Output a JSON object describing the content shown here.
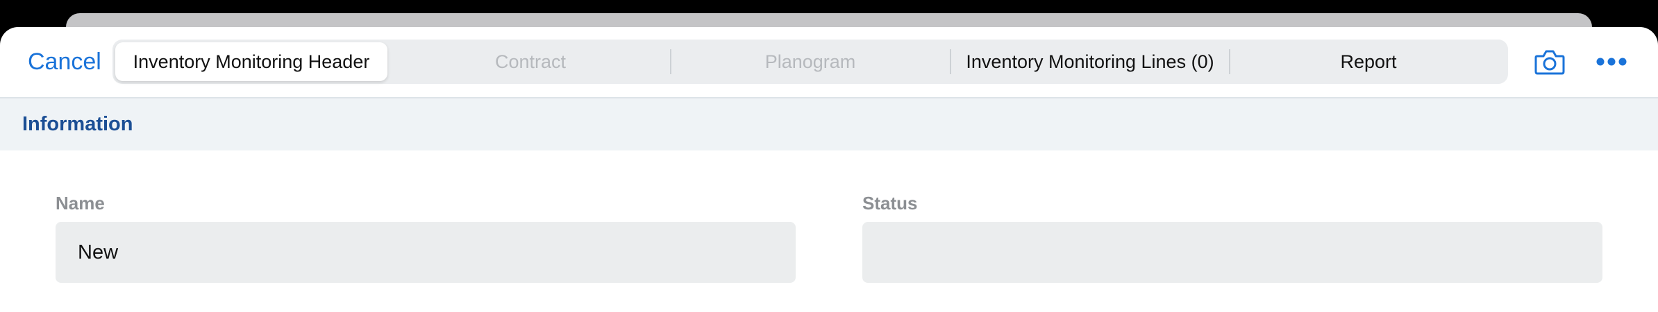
{
  "toolbar": {
    "cancel_label": "Cancel",
    "tabs": [
      {
        "label": "Inventory Monitoring Header",
        "state": "active"
      },
      {
        "label": "Contract",
        "state": "disabled"
      },
      {
        "label": "Planogram",
        "state": "disabled"
      },
      {
        "label": "Inventory Monitoring Lines (0)",
        "state": "enabled"
      },
      {
        "label": "Report",
        "state": "enabled"
      }
    ],
    "camera_icon": "camera-icon",
    "more_icon": "more-horizontal-icon"
  },
  "section": {
    "title": "Information"
  },
  "fields": {
    "name": {
      "label": "Name",
      "value": "New"
    },
    "status": {
      "label": "Status",
      "value": ""
    }
  },
  "colors": {
    "accent": "#1a73d9",
    "section_title": "#1c4f95",
    "section_bg": "#eff3f6",
    "field_bg": "#ebedee"
  }
}
